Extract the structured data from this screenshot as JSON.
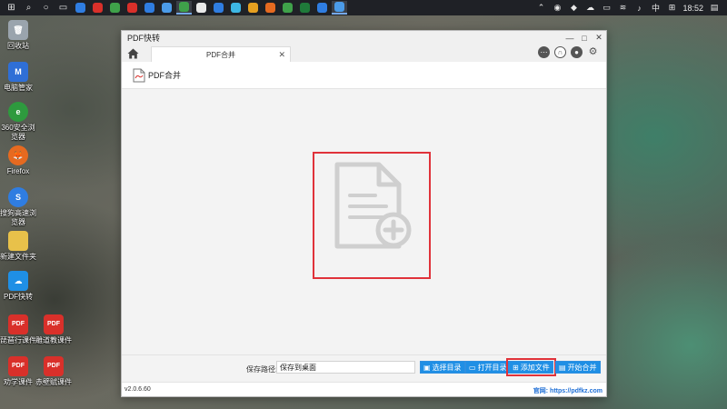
{
  "taskbar": {
    "time": "18:52",
    "lang": "中",
    "icons": [
      {
        "name": "windows-start-icon",
        "glyph": "⊞",
        "color": "#ffffff"
      },
      {
        "name": "search-icon",
        "glyph": "⌕",
        "color": "#ffffff"
      },
      {
        "name": "cortana-icon",
        "glyph": "○",
        "color": "#ffffff"
      },
      {
        "name": "task-view-icon",
        "glyph": "▭",
        "color": "#ffffff"
      },
      {
        "name": "app-icon",
        "glyph": "",
        "color": "#2f7de1"
      },
      {
        "name": "app-icon",
        "glyph": "",
        "color": "#d9302a"
      },
      {
        "name": "app-icon",
        "glyph": "",
        "color": "#3fa14a"
      },
      {
        "name": "app-icon",
        "glyph": "",
        "color": "#d9302a"
      },
      {
        "name": "app-icon",
        "glyph": "",
        "color": "#2f7de1"
      },
      {
        "name": "app-icon",
        "glyph": "",
        "color": "#4b9be8"
      },
      {
        "name": "app-icon",
        "glyph": "",
        "color": "#3fa14a"
      },
      {
        "name": "app-icon",
        "glyph": "",
        "color": "#e9e9e9"
      },
      {
        "name": "app-icon",
        "glyph": "",
        "color": "#2f7de1"
      },
      {
        "name": "app-icon",
        "glyph": "",
        "color": "#3db7e4"
      },
      {
        "name": "app-icon",
        "glyph": "",
        "color": "#e6a020"
      },
      {
        "name": "app-icon",
        "glyph": "",
        "color": "#e66a20"
      },
      {
        "name": "app-icon",
        "glyph": "",
        "color": "#3fa14a"
      },
      {
        "name": "app-icon",
        "glyph": "",
        "color": "#1f7a3a"
      },
      {
        "name": "app-icon",
        "glyph": "",
        "color": "#2f7de1"
      },
      {
        "name": "app-icon",
        "glyph": "",
        "color": "#4b9be8"
      }
    ]
  },
  "desktop": {
    "icons": [
      {
        "label": "回收站",
        "color": "#9aa4ad",
        "glyph": "🗑"
      },
      {
        "label": "电脑管家",
        "color": "#2f6fd6",
        "glyph": "M"
      },
      {
        "label": "360安全浏览器",
        "color": "#2e9a3e",
        "glyph": "e"
      },
      {
        "label": "Firefox",
        "color": "#e66a20",
        "glyph": "🦊"
      },
      {
        "label": "搜狗高速浏览器",
        "color": "#2f7de1",
        "glyph": "S"
      },
      {
        "label": "新建文件夹",
        "color": "#e8c14a",
        "glyph": ""
      },
      {
        "label": "PDF快转",
        "color": "#1f8fe5",
        "glyph": "☁"
      },
      {
        "label": "琵琶行课件",
        "color": "#d9302a",
        "glyph": "PDF"
      },
      {
        "label": "雕道教课件",
        "color": "#d9302a",
        "glyph": "PDF"
      },
      {
        "label": "劝学课件",
        "color": "#d9302a",
        "glyph": "PDF"
      },
      {
        "label": "赤壁赋课件",
        "color": "#d9302a",
        "glyph": "PDF"
      }
    ]
  },
  "window": {
    "title": "PDF快转",
    "controls": {
      "minimize": "—",
      "maximize": "□",
      "close": "✕"
    },
    "tab": {
      "label": "PDF合并",
      "close": "✕"
    },
    "subheader": {
      "title": "PDF合并"
    },
    "dropzone": {
      "hint": ""
    },
    "bottom": {
      "save_label": "保存路径:",
      "save_value": "保存到桌面",
      "buttons": {
        "choose_dir": "选择目录",
        "open_dir": "打开目录",
        "add_file": "添加文件",
        "start_merge": "开始合并"
      }
    },
    "status": {
      "version": "v2.0.6.60",
      "site_label": "官网:",
      "site_url": "https://pdfkz.com"
    }
  },
  "colors": {
    "accent": "#1f8fe5",
    "highlight": "#e0323a"
  }
}
